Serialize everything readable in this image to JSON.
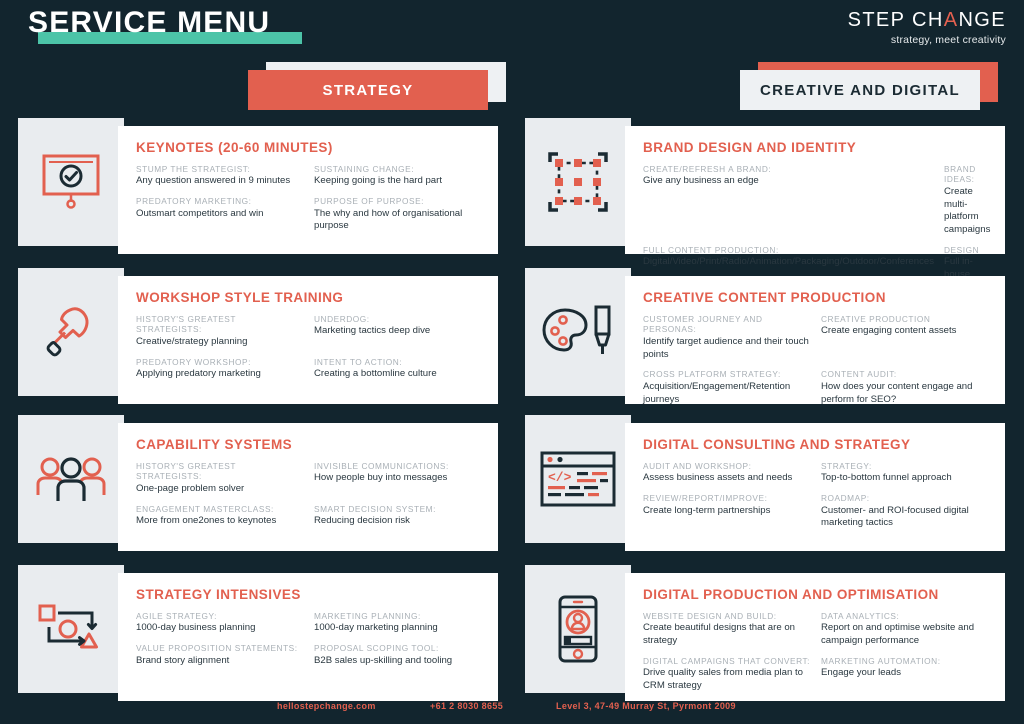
{
  "header": {
    "title": "SERVICE MENU",
    "logo_name_part1": "STEP CH",
    "logo_name_accent": "A",
    "logo_name_part2": "NGE",
    "logo_tagline": "strategy, meet creativity"
  },
  "colors": {
    "background": "#12252e",
    "accent_coral": "#e2604f",
    "accent_teal": "#4cc4a8",
    "panel_light": "#e9ecef",
    "card_white": "#ffffff",
    "label_gray": "#a9b0b6",
    "text_dark": "#2a3840"
  },
  "columns": [
    {
      "id": "strategy",
      "label": "STRATEGY"
    },
    {
      "id": "creative",
      "label": "CREATIVE AND DIGITAL"
    }
  ],
  "cards": [
    {
      "icon": "presentation-check-icon",
      "title": "KEYNOTES (20-60 MINUTES)",
      "items": [
        {
          "label": "STUMP THE STRATEGIST:",
          "desc": "Any question answered in 9 minutes"
        },
        {
          "label": "SUSTAINING CHANGE:",
          "desc": "Keeping going is the hard part"
        },
        {
          "label": "PREDATORY MARKETING:",
          "desc": "Outsmart competitors and win"
        },
        {
          "label": "PURPOSE OF PURPOSE:",
          "desc": "The why and how of organisational purpose"
        }
      ]
    },
    {
      "icon": "hammer-icon",
      "title": "WORKSHOP STYLE TRAINING",
      "items": [
        {
          "label": "HISTORY'S GREATEST STRATEGISTS:",
          "desc": "Creative/strategy planning"
        },
        {
          "label": "UNDERDOG:",
          "desc": "Marketing tactics deep dive"
        },
        {
          "label": "PREDATORY WORKSHOP:",
          "desc": "Applying predatory marketing"
        },
        {
          "label": "INTENT TO ACTION:",
          "desc": "Creating a bottomline culture"
        }
      ]
    },
    {
      "icon": "people-group-icon",
      "title": "CAPABILITY SYSTEMS",
      "items": [
        {
          "label": "HISTORY'S GREATEST STRATEGISTS:",
          "desc": "One-page problem solver"
        },
        {
          "label": "INVISIBLE COMMUNICATIONS:",
          "desc": "How people buy into messages"
        },
        {
          "label": "ENGAGEMENT MASTERCLASS:",
          "desc": "More from one2ones to keynotes"
        },
        {
          "label": "SMART DECISION SYSTEM:",
          "desc": "Reducing decision risk"
        }
      ]
    },
    {
      "icon": "flowchart-shapes-icon",
      "title": "STRATEGY INTENSIVES",
      "items": [
        {
          "label": "AGILE STRATEGY:",
          "desc": "1000-day business planning"
        },
        {
          "label": "MARKETING PLANNING:",
          "desc": "1000-day marketing planning"
        },
        {
          "label": "VALUE PROPOSITION STATEMENTS:",
          "desc": "Brand story alignment"
        },
        {
          "label": "PROPOSAL SCOPING TOOL:",
          "desc": "B2B sales up-skilling and tooling"
        }
      ]
    },
    {
      "icon": "selection-handles-icon",
      "title": "BRAND DESIGN AND IDENTITY",
      "items": [
        {
          "label": "CREATE/REFRESH A BRAND:",
          "desc": "Give any business an edge"
        },
        {
          "label": "BRAND IDEAS:",
          "desc": "Create multi-platform campaigns"
        },
        {
          "label": "FULL CONTENT PRODUCTION:",
          "desc": "Digital/Video/Print/Radio/Animation/Packaging/Outdoor/Conferences"
        },
        {
          "label": "DESIGN",
          "desc": "Full in-house design studio"
        }
      ]
    },
    {
      "icon": "palette-brush-icon",
      "title": "CREATIVE CONTENT PRODUCTION",
      "items": [
        {
          "label": "CUSTOMER JOURNEY AND PERSONAS:",
          "desc": "Identify target audience and their touch points"
        },
        {
          "label": "CREATIVE PRODUCTION",
          "desc": "Create engaging content assets"
        },
        {
          "label": "CROSS PLATFORM STRATEGY:",
          "desc": "Acquisition/Engagement/Retention journeys"
        },
        {
          "label": "CONTENT AUDIT:",
          "desc": "How does your content engage and perform for SEO?"
        }
      ]
    },
    {
      "icon": "code-browser-icon",
      "title": "DIGITAL CONSULTING AND STRATEGY",
      "items": [
        {
          "label": "AUDIT AND WORKSHOP:",
          "desc": "Assess business assets and needs"
        },
        {
          "label": "STRATEGY:",
          "desc": "Top-to-bottom funnel approach"
        },
        {
          "label": "REVIEW/REPORT/IMPROVE:",
          "desc": "Create long-term partnerships"
        },
        {
          "label": "ROADMAP:",
          "desc": "Customer- and ROI-focused digital marketing tactics"
        }
      ]
    },
    {
      "icon": "mobile-user-icon",
      "title": "DIGITAL PRODUCTION AND OPTIMISATION",
      "items": [
        {
          "label": "WEBSITE DESIGN AND BUILD:",
          "desc": "Create beautiful designs that are on strategy"
        },
        {
          "label": "DATA ANALYTICS:",
          "desc": "Report on and optimise website and campaign performance"
        },
        {
          "label": "DIGITAL CAMPAIGNS THAT CONVERT:",
          "desc": "Drive quality sales from media plan to CRM strategy"
        },
        {
          "label": "MARKETING AUTOMATION:",
          "desc": "Engage your leads"
        }
      ]
    }
  ],
  "footer": {
    "website": "hellostepchange.com",
    "phone": "+61 2 8030 8655",
    "address": "Level 3, 47-49 Murray St, Pyrmont 2009"
  }
}
